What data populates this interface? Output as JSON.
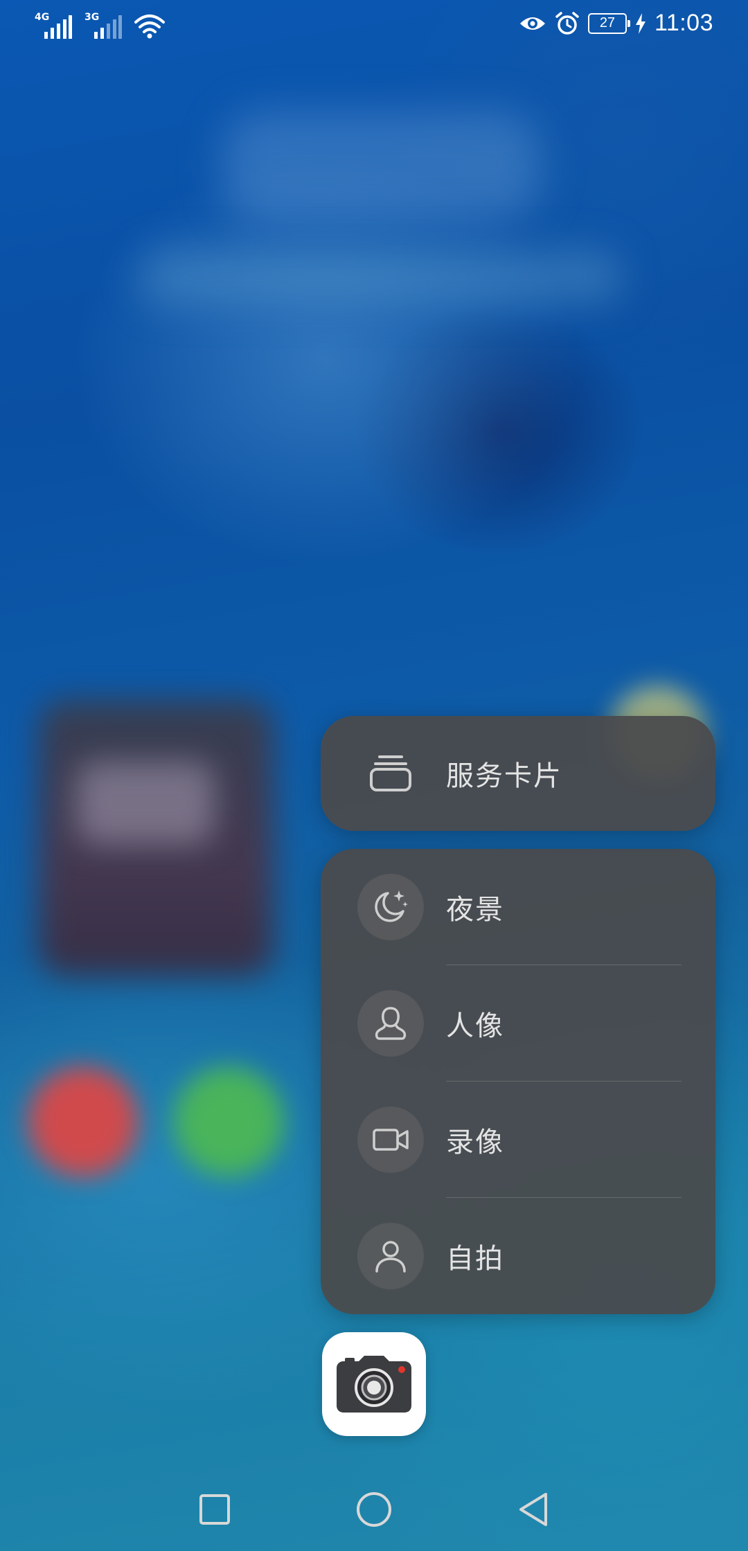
{
  "status_bar": {
    "sim1_label": "4G",
    "sim2_label": "3G",
    "battery_level": "27",
    "time": "11:03",
    "icons": [
      "signal-icon",
      "wifi-icon",
      "eye-comfort-icon",
      "alarm-icon",
      "battery-icon",
      "charging-icon"
    ]
  },
  "menu": {
    "service_card": {
      "label": "服务卡片",
      "icon": "service-card-icon"
    },
    "items": [
      {
        "label": "夜景",
        "icon": "night-mode-icon"
      },
      {
        "label": "人像",
        "icon": "portrait-icon"
      },
      {
        "label": "录像",
        "icon": "video-icon"
      },
      {
        "label": "自拍",
        "icon": "selfie-icon"
      }
    ]
  },
  "app": {
    "icon": "camera-app-icon"
  },
  "nav_bar": {
    "icons": [
      "recent-apps-icon",
      "home-icon",
      "back-icon"
    ]
  },
  "colors": {
    "menu_background": "#4a4a4c",
    "menu_text": "#e4e4e4",
    "camera_red_dot": "#e0372d"
  }
}
